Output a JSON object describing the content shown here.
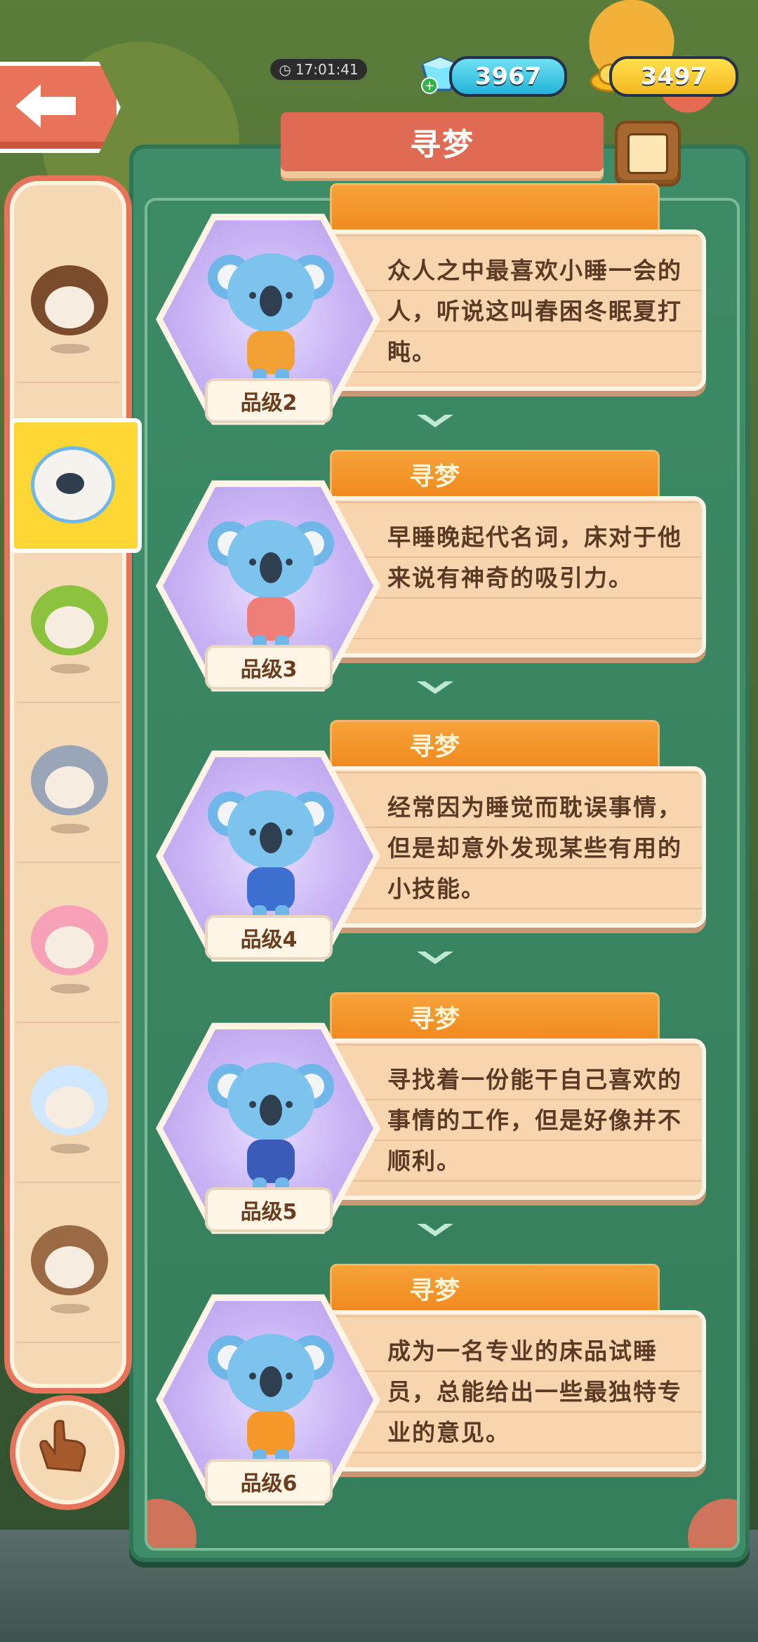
{
  "hud": {
    "timer": "17:01:41",
    "gems": "3967",
    "gold": "3497"
  },
  "title": "寻梦",
  "cards": [
    {
      "name": "",
      "desc": "众人之中最喜欢小睡一会的人，听说这叫春困冬眠夏打盹。",
      "grade": "品级2",
      "shirt": "#f2a234"
    },
    {
      "name": "寻梦",
      "desc": "早睡晚起代名词，床对于他来说有神奇的吸引力。",
      "grade": "品级3",
      "shirt": "#ef7d78"
    },
    {
      "name": "寻梦",
      "desc": "经常因为睡觉而耽误事情，但是却意外发现某些有用的小技能。",
      "grade": "品级4",
      "shirt": "#3d6fd1"
    },
    {
      "name": "寻梦",
      "desc": "寻找着一份能干自己喜欢的事情的工作，但是好像并不顺利。",
      "grade": "品级5",
      "shirt": "#3b5bb8"
    },
    {
      "name": "寻梦",
      "desc": "成为一名专业的床品试睡员，总能给出一些最独特专业的意见。",
      "grade": "品级6",
      "shirt": "#f59a2a"
    }
  ],
  "rail": [
    {
      "name": "raccoon",
      "color": "#7a4b2c"
    },
    {
      "name": "koala",
      "color": "#6fb7e8"
    },
    {
      "name": "frog",
      "color": "#8dc23e"
    },
    {
      "name": "husky",
      "color": "#9aa6b7"
    },
    {
      "name": "cat",
      "color": "#f6a1b8"
    },
    {
      "name": "ghost",
      "color": "#cfe7ff"
    },
    {
      "name": "hedgehog",
      "color": "#9a6a44"
    }
  ]
}
